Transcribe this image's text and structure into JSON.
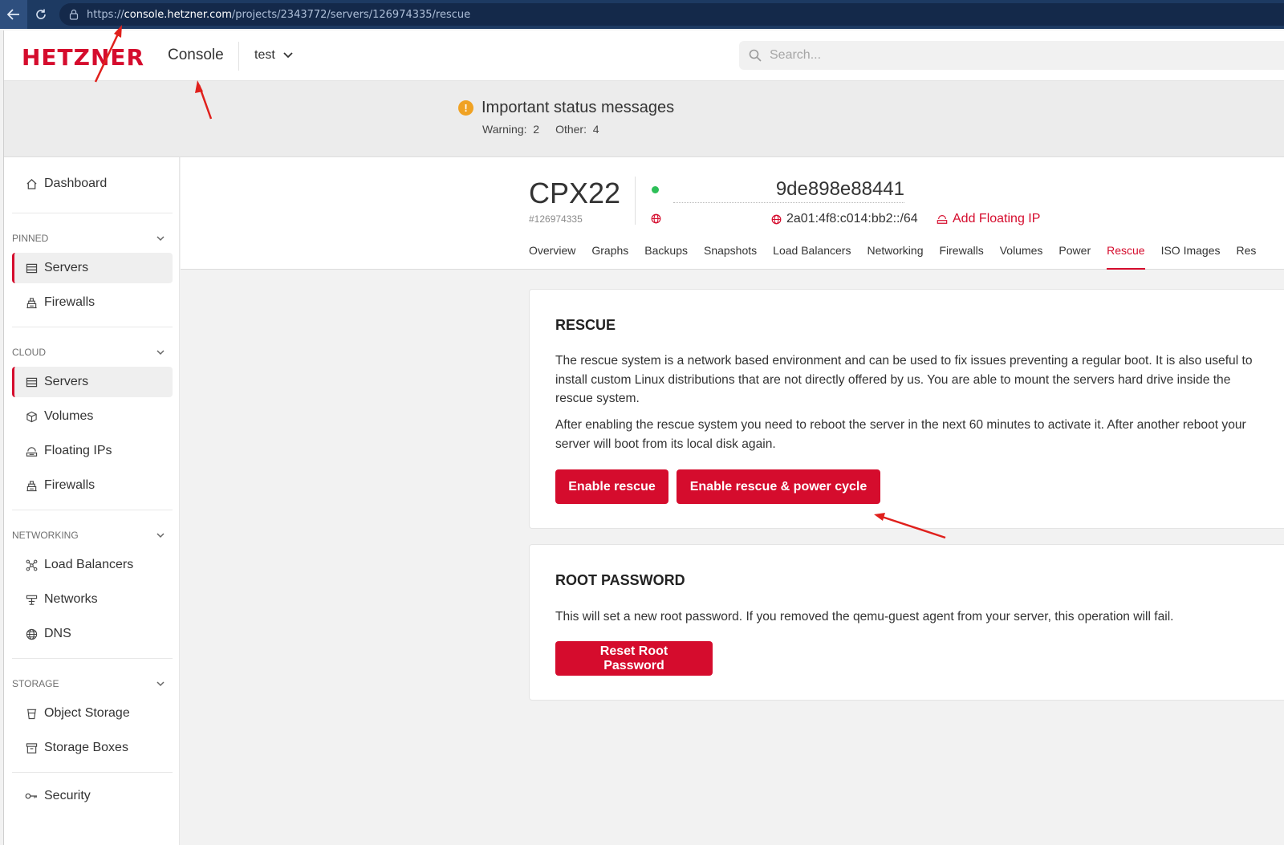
{
  "browser": {
    "url_scheme": "https://",
    "url_domain": "console.hetzner.com",
    "url_path": "/projects/2343772/servers/126974335/rescue"
  },
  "header": {
    "logo": "HETZNER",
    "app_name": "Console",
    "project": "test",
    "search_placeholder": "Search..."
  },
  "status": {
    "title": "Important status messages",
    "warning": "Warning:  2",
    "other": "Other:  4"
  },
  "sidebar": {
    "dashboard": "Dashboard",
    "pinned_head": "PINNED",
    "pinned": [
      "Servers",
      "Firewalls"
    ],
    "cloud_head": "CLOUD",
    "cloud": [
      "Servers",
      "Volumes",
      "Floating IPs",
      "Firewalls"
    ],
    "networking_head": "NETWORKING",
    "networking": [
      "Load Balancers",
      "Networks",
      "DNS"
    ],
    "storage_head": "STORAGE",
    "storage": [
      "Object Storage",
      "Storage Boxes"
    ],
    "security": "Security"
  },
  "server": {
    "name": "CPX22",
    "id": "#126974335",
    "hostname": "9de898e88441",
    "ipv6": "2a01:4f8:c014:bb2::/64",
    "add_floating_ip": "Add Floating IP",
    "tabs": [
      "Overview",
      "Graphs",
      "Backups",
      "Snapshots",
      "Load Balancers",
      "Networking",
      "Firewalls",
      "Volumes",
      "Power",
      "Rescue",
      "ISO Images",
      "Res"
    ],
    "active_tab": "Rescue"
  },
  "rescue": {
    "title": "RESCUE",
    "para1": "The rescue system is a network based environment and can be used to fix issues preventing a regular boot. It is also useful to install custom Linux distributions that are not directly offered by us. You are able to mount the servers hard drive inside the rescue system.",
    "para2": "After enabling the rescue system you need to reboot the server in the next 60 minutes to activate it. After another reboot your server will boot from its local disk again.",
    "enable_button": "Enable rescue",
    "enable_cycle_button": "Enable rescue & power cycle"
  },
  "root_password": {
    "title": "ROOT PASSWORD",
    "para": "This will set a new root password. If you removed the qemu-guest agent from your server, this operation will fail.",
    "button": "Reset Root Password"
  },
  "colors": {
    "brand": "#d50c2d",
    "status_online": "#2dbf58",
    "warning": "#f0a223",
    "annotation": "#e0201c"
  }
}
